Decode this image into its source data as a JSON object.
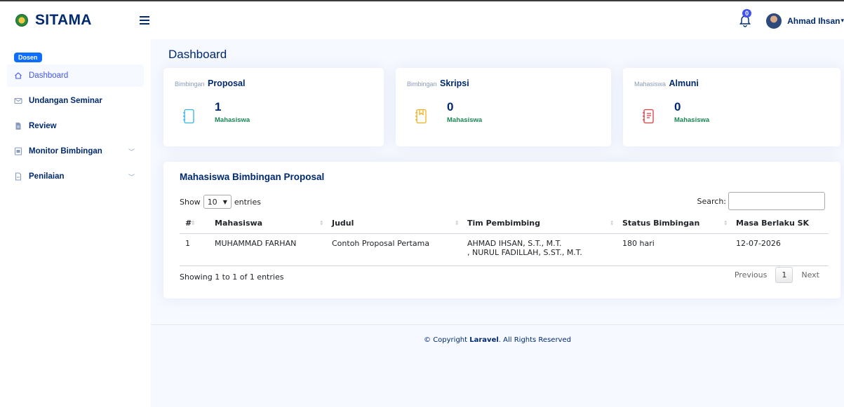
{
  "app": {
    "name": "SITAMA"
  },
  "topbar": {
    "notification_count": "0",
    "user_name": "Ahmad Ihsan"
  },
  "sidebar": {
    "role_badge": "Dosen",
    "items": [
      {
        "label": "Dashboard",
        "icon": "house-icon"
      },
      {
        "label": "Undangan Seminar",
        "icon": "envelope-icon"
      },
      {
        "label": "Review",
        "icon": "file-text-icon"
      },
      {
        "label": "Monitor Bimbingan",
        "icon": "chart-doc-icon"
      },
      {
        "label": "Penilaian",
        "icon": "file-icon"
      }
    ]
  },
  "page": {
    "title": "Dashboard"
  },
  "cards": [
    {
      "prefix": "Bimbingan",
      "title": "Proposal",
      "count": "1",
      "unit": "Mahasiswa",
      "icon": "notebook-icon",
      "color": "#2eb6e8"
    },
    {
      "prefix": "Bimbingan",
      "title": "Skripsi",
      "count": "0",
      "unit": "Mahasiswa",
      "icon": "journal-bookmark-icon",
      "color": "#f2b01e"
    },
    {
      "prefix": "Mahasiswa",
      "title": "Almuni",
      "count": "0",
      "unit": "Mahasiswa",
      "icon": "journal-text-icon",
      "color": "#e0393e"
    }
  ],
  "table_section": {
    "title": "Mahasiswa Bimbingan Proposal",
    "show_label": "Show",
    "entries_value": "10",
    "entries_label": "entries",
    "search_label": "Search:",
    "columns": [
      "#",
      "Mahasiswa",
      "Judul",
      "Tim Pembimbing",
      "Status Bimbingan",
      "Masa Berlaku SK"
    ],
    "rows": [
      {
        "no": "1",
        "mahasiswa": "MUHAMMAD FARHAN",
        "judul": "Contoh Proposal Pertama",
        "pembimbing_1": "AHMAD IHSAN, S.T., M.T.",
        "pembimbing_2": ", NURUL FADILLAH, S.ST., M.T.",
        "status": "180 hari",
        "masa_berlaku": "12-07-2026"
      }
    ],
    "info": "Showing 1 to 1 of 1 entries",
    "prev_label": "Previous",
    "current_page": "1",
    "next_label": "Next"
  },
  "footer": {
    "prefix": "© Copyright",
    "brand": "Laravel",
    "suffix": ". All Rights Reserved"
  },
  "colors": {
    "navy": "#012970",
    "accent": "#4154f1",
    "success": "#198754",
    "badge": "#0d6efd"
  }
}
